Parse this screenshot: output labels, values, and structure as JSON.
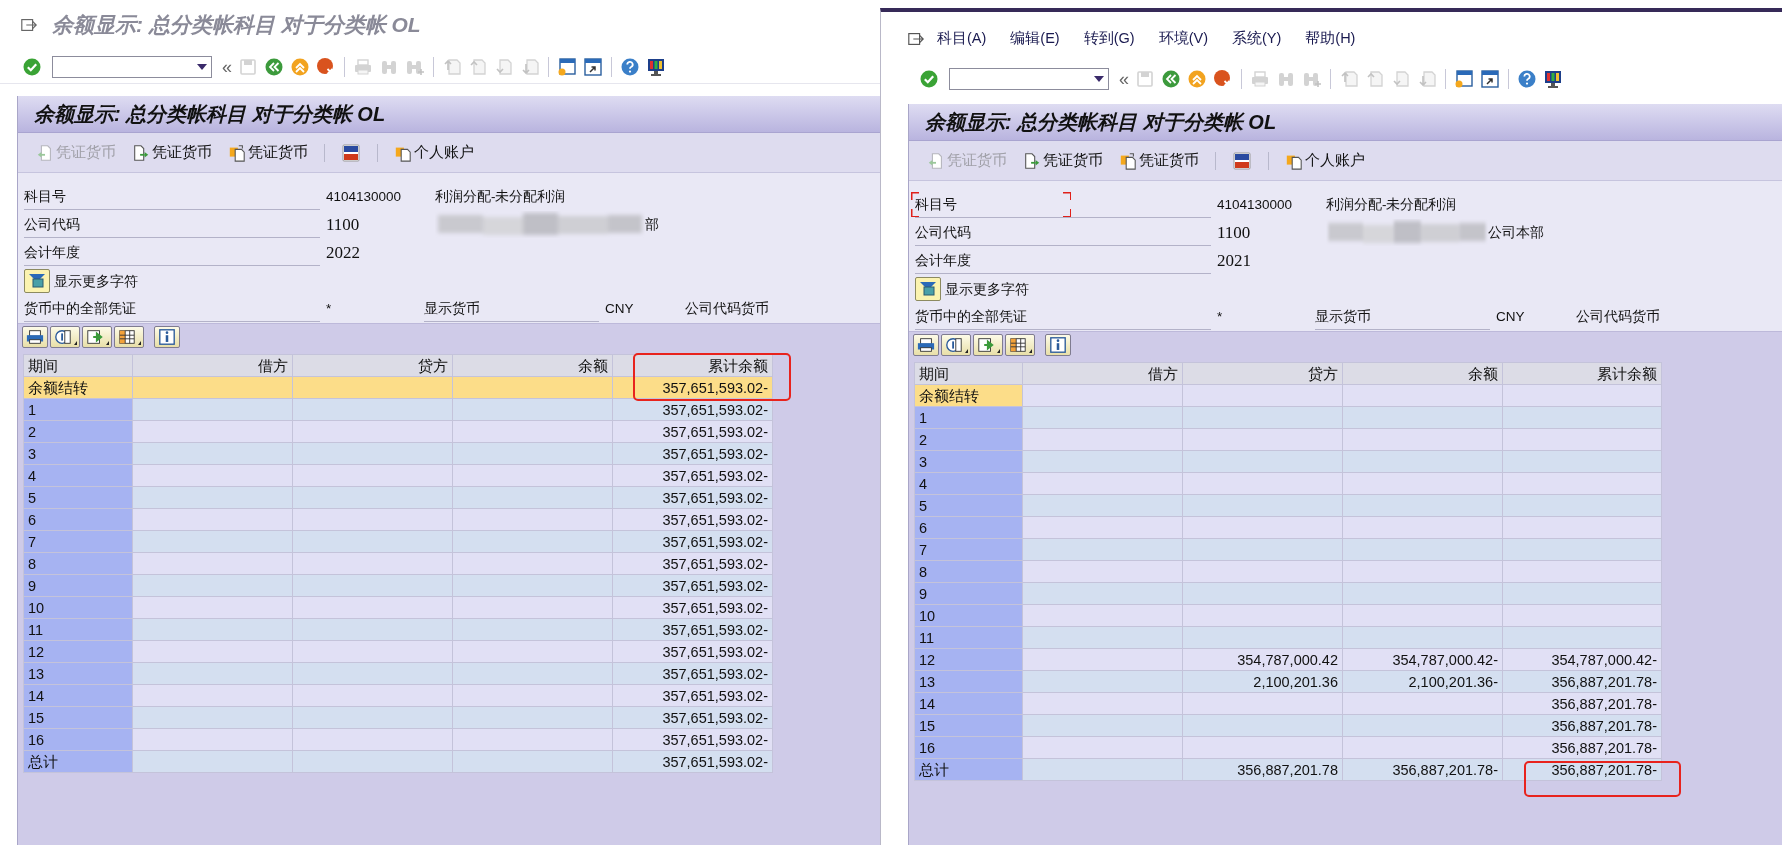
{
  "windows": [
    {
      "title": "余额显示: 总分类帐科目 对于分类帐 OL",
      "system_toolbar": [
        {
          "kind": "enter",
          "disabled": false
        },
        {
          "kind": "command_field"
        },
        {
          "kind": "collapse",
          "label": "«",
          "disabled": false
        },
        {
          "kind": "save",
          "disabled": true
        },
        {
          "kind": "back",
          "disabled": false
        },
        {
          "kind": "exit",
          "disabled": false
        },
        {
          "kind": "cancel",
          "disabled": false
        },
        {
          "kind": "separator"
        },
        {
          "kind": "print",
          "disabled": true
        },
        {
          "kind": "find",
          "disabled": true
        },
        {
          "kind": "find_next",
          "disabled": true
        },
        {
          "kind": "separator"
        },
        {
          "kind": "first_page",
          "disabled": true
        },
        {
          "kind": "previous_page",
          "disabled": true
        },
        {
          "kind": "next_page",
          "disabled": true
        },
        {
          "kind": "last_page",
          "disabled": true
        },
        {
          "kind": "separator"
        },
        {
          "kind": "new_session",
          "disabled": false
        },
        {
          "kind": "shortcut",
          "disabled": false
        },
        {
          "kind": "separator"
        },
        {
          "kind": "help",
          "disabled": false
        },
        {
          "kind": "layout",
          "disabled": false
        }
      ],
      "panel_title": "余额显示: 总分类帐科目 对于分类帐 OL",
      "app_toolbar": [
        {
          "kind": "doc_back",
          "label": "凭证货币",
          "disabled": true
        },
        {
          "kind": "doc_forward",
          "label": "凭证货币",
          "disabled": false
        },
        {
          "kind": "doc_swap",
          "label": "凭证货币",
          "disabled": false
        },
        {
          "kind": "separator"
        },
        {
          "kind": "currency",
          "disabled": false
        },
        {
          "kind": "separator"
        },
        {
          "kind": "account",
          "label": "个人账户",
          "disabled": false
        }
      ],
      "fields": [
        {
          "label": "科目号",
          "value": "4104130000",
          "kind": "code",
          "description": "利润分配-未分配利润",
          "focused": false
        },
        {
          "label": "公司代码",
          "value": "1100",
          "kind": "number",
          "description": "部",
          "redacted": true,
          "focused": false
        },
        {
          "label": "会计年度",
          "value": "2022",
          "kind": "number",
          "focused": false
        }
      ],
      "more_button": "显示更多字符",
      "currency_row": [
        {
          "kind": "label",
          "text": "货币中的全部凭证"
        },
        {
          "kind": "value",
          "text": "*"
        },
        {
          "kind": "label",
          "text": "显示货币"
        },
        {
          "kind": "value",
          "text": "CNY"
        },
        {
          "kind": "value",
          "text": "公司代码货币"
        }
      ],
      "table": {
        "header_framed": true,
        "columns": [
          {
            "label": "期间"
          },
          {
            "label": "借方"
          },
          {
            "label": "贷方"
          },
          {
            "label": "余额"
          },
          {
            "label": "累计余额"
          }
        ],
        "rows": [
          {
            "cells": [
              "余额结转",
              null,
              null,
              null,
              "357,651,593.02-"
            ],
            "selected": true,
            "current": true,
            "framed": true
          },
          {
            "cells": [
              "1",
              null,
              null,
              null,
              "357,651,593.02-"
            ],
            "selected": false,
            "current": false,
            "framed": false
          },
          {
            "cells": [
              "2",
              null,
              null,
              null,
              "357,651,593.02-"
            ],
            "selected": false,
            "current": false,
            "framed": false
          },
          {
            "cells": [
              "3",
              null,
              null,
              null,
              "357,651,593.02-"
            ],
            "selected": false,
            "current": false,
            "framed": false
          },
          {
            "cells": [
              "4",
              null,
              null,
              null,
              "357,651,593.02-"
            ],
            "selected": false,
            "current": false,
            "framed": false
          },
          {
            "cells": [
              "5",
              null,
              null,
              null,
              "357,651,593.02-"
            ],
            "selected": false,
            "current": false,
            "framed": false
          },
          {
            "cells": [
              "6",
              null,
              null,
              null,
              "357,651,593.02-"
            ],
            "selected": false,
            "current": false,
            "framed": false
          },
          {
            "cells": [
              "7",
              null,
              null,
              null,
              "357,651,593.02-"
            ],
            "selected": false,
            "current": false,
            "framed": false
          },
          {
            "cells": [
              "8",
              null,
              null,
              null,
              "357,651,593.02-"
            ],
            "selected": false,
            "current": false,
            "framed": false
          },
          {
            "cells": [
              "9",
              null,
              null,
              null,
              "357,651,593.02-"
            ],
            "selected": false,
            "current": false,
            "framed": false
          },
          {
            "cells": [
              "10",
              null,
              null,
              null,
              "357,651,593.02-"
            ],
            "selected": false,
            "current": false,
            "framed": false
          },
          {
            "cells": [
              "11",
              null,
              null,
              null,
              "357,651,593.02-"
            ],
            "selected": false,
            "current": false,
            "framed": false
          },
          {
            "cells": [
              "12",
              null,
              null,
              null,
              "357,651,593.02-"
            ],
            "selected": false,
            "current": false,
            "framed": false
          },
          {
            "cells": [
              "13",
              null,
              null,
              null,
              "357,651,593.02-"
            ],
            "selected": false,
            "current": false,
            "framed": false
          },
          {
            "cells": [
              "14",
              null,
              null,
              null,
              "357,651,593.02-"
            ],
            "selected": false,
            "current": false,
            "framed": false
          },
          {
            "cells": [
              "15",
              null,
              null,
              null,
              "357,651,593.02-"
            ],
            "selected": false,
            "current": false,
            "framed": false
          },
          {
            "cells": [
              "16",
              null,
              null,
              null,
              "357,651,593.02-"
            ],
            "selected": false,
            "current": false,
            "framed": false
          },
          {
            "cells": [
              "总计",
              null,
              null,
              null,
              "357,651,593.02-"
            ],
            "selected": false,
            "current": false,
            "framed": false
          }
        ]
      }
    },
    {
      "menus": [
        "科目(A)",
        "编辑(E)",
        "转到(G)",
        "环境(V)",
        "系统(Y)",
        "帮助(H)"
      ],
      "system_toolbar": [
        {
          "kind": "enter",
          "disabled": false
        },
        {
          "kind": "command_field"
        },
        {
          "kind": "collapse",
          "label": "«",
          "disabled": false
        },
        {
          "kind": "save",
          "disabled": true
        },
        {
          "kind": "back",
          "disabled": false
        },
        {
          "kind": "exit",
          "disabled": false
        },
        {
          "kind": "cancel",
          "disabled": false
        },
        {
          "kind": "separator"
        },
        {
          "kind": "print",
          "disabled": true
        },
        {
          "kind": "find",
          "disabled": true
        },
        {
          "kind": "find_next",
          "disabled": true
        },
        {
          "kind": "separator"
        },
        {
          "kind": "first_page",
          "disabled": true
        },
        {
          "kind": "previous_page",
          "disabled": true
        },
        {
          "kind": "next_page",
          "disabled": true
        },
        {
          "kind": "last_page",
          "disabled": true
        },
        {
          "kind": "separator"
        },
        {
          "kind": "new_session",
          "disabled": false
        },
        {
          "kind": "shortcut",
          "disabled": false
        },
        {
          "kind": "separator"
        },
        {
          "kind": "help",
          "disabled": false
        },
        {
          "kind": "layout",
          "disabled": false
        }
      ],
      "panel_title": "余额显示: 总分类帐科目 对于分类帐 OL",
      "app_toolbar": [
        {
          "kind": "doc_back",
          "label": "凭证货币",
          "disabled": true
        },
        {
          "kind": "doc_forward",
          "label": "凭证货币",
          "disabled": false
        },
        {
          "kind": "doc_swap",
          "label": "凭证货币",
          "disabled": false
        },
        {
          "kind": "separator"
        },
        {
          "kind": "currency",
          "disabled": false
        },
        {
          "kind": "separator"
        },
        {
          "kind": "account",
          "label": "个人账户",
          "disabled": false
        }
      ],
      "fields": [
        {
          "label": "科目号",
          "value": "4104130000",
          "kind": "code",
          "description": "利润分配-未分配利润",
          "focused": true
        },
        {
          "label": "公司代码",
          "value": "1100",
          "kind": "number",
          "description": "公司本部",
          "redacted": true,
          "focused": false
        },
        {
          "label": "会计年度",
          "value": "2021",
          "kind": "number",
          "focused": false
        }
      ],
      "more_button": "显示更多字符",
      "currency_row": [
        {
          "kind": "label",
          "text": "货币中的全部凭证"
        },
        {
          "kind": "value",
          "text": "*"
        },
        {
          "kind": "label",
          "text": "显示货币"
        },
        {
          "kind": "value",
          "text": "CNY"
        },
        {
          "kind": "value",
          "text": "公司代码货币"
        }
      ],
      "table": {
        "header_framed": false,
        "columns": [
          {
            "label": "期间"
          },
          {
            "label": "借方"
          },
          {
            "label": "贷方"
          },
          {
            "label": "余额"
          },
          {
            "label": "累计余额"
          }
        ],
        "rows": [
          {
            "cells": [
              "余额结转",
              null,
              null,
              null,
              null
            ],
            "selected": false,
            "current": true,
            "framed": false
          },
          {
            "cells": [
              "1",
              null,
              null,
              null,
              null
            ],
            "selected": false,
            "current": false,
            "framed": false
          },
          {
            "cells": [
              "2",
              null,
              null,
              null,
              null
            ],
            "selected": false,
            "current": false,
            "framed": false
          },
          {
            "cells": [
              "3",
              null,
              null,
              null,
              null
            ],
            "selected": false,
            "current": false,
            "framed": false
          },
          {
            "cells": [
              "4",
              null,
              null,
              null,
              null
            ],
            "selected": false,
            "current": false,
            "framed": false
          },
          {
            "cells": [
              "5",
              null,
              null,
              null,
              null
            ],
            "selected": false,
            "current": false,
            "framed": false
          },
          {
            "cells": [
              "6",
              null,
              null,
              null,
              null
            ],
            "selected": false,
            "current": false,
            "framed": false
          },
          {
            "cells": [
              "7",
              null,
              null,
              null,
              null
            ],
            "selected": false,
            "current": false,
            "framed": false
          },
          {
            "cells": [
              "8",
              null,
              null,
              null,
              null
            ],
            "selected": false,
            "current": false,
            "framed": false
          },
          {
            "cells": [
              "9",
              null,
              null,
              null,
              null
            ],
            "selected": false,
            "current": false,
            "framed": false
          },
          {
            "cells": [
              "10",
              null,
              null,
              null,
              null
            ],
            "selected": false,
            "current": false,
            "framed": false
          },
          {
            "cells": [
              "11",
              null,
              null,
              null,
              null
            ],
            "selected": false,
            "current": false,
            "framed": false
          },
          {
            "cells": [
              "12",
              null,
              "354,787,000.42",
              "354,787,000.42-",
              "354,787,000.42-"
            ],
            "selected": false,
            "current": false,
            "framed": false
          },
          {
            "cells": [
              "13",
              null,
              "2,100,201.36",
              "2,100,201.36-",
              "356,887,201.78-"
            ],
            "selected": false,
            "current": false,
            "framed": false
          },
          {
            "cells": [
              "14",
              null,
              null,
              null,
              "356,887,201.78-"
            ],
            "selected": false,
            "current": false,
            "framed": false
          },
          {
            "cells": [
              "15",
              null,
              null,
              null,
              "356,887,201.78-"
            ],
            "selected": false,
            "current": false,
            "framed": false
          },
          {
            "cells": [
              "16",
              null,
              null,
              null,
              "356,887,201.78-"
            ],
            "selected": false,
            "current": false,
            "framed": false
          },
          {
            "cells": [
              "总计",
              null,
              "356,887,201.78",
              "356,887,201.78-",
              "356,887,201.78-"
            ],
            "selected": false,
            "current": false,
            "framed": true
          }
        ]
      }
    }
  ]
}
